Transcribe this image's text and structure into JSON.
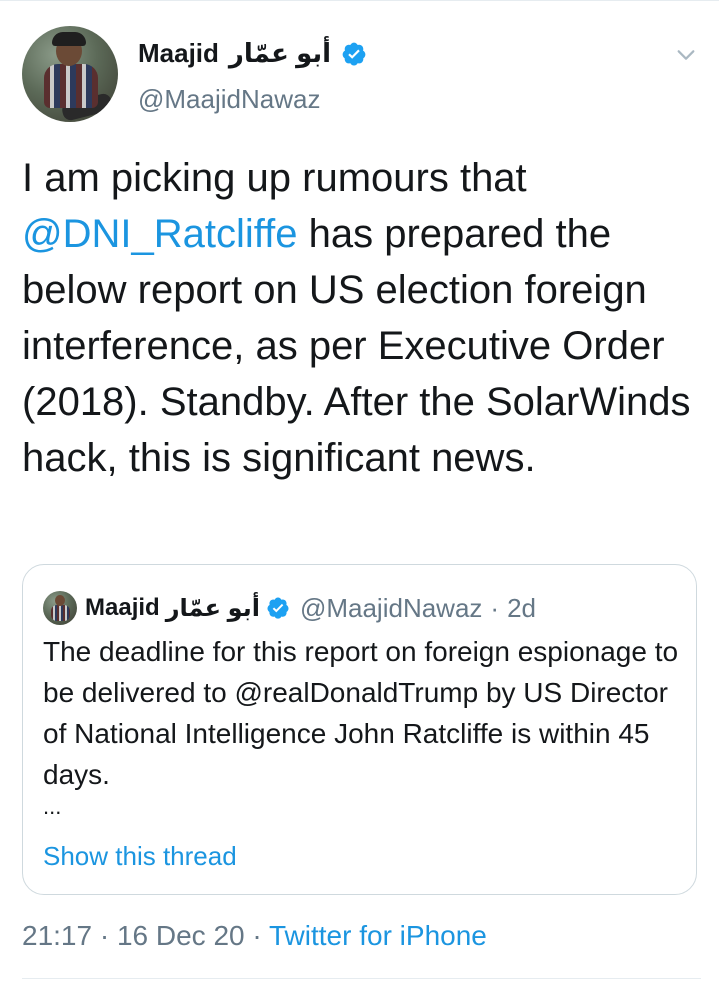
{
  "tweet": {
    "author": {
      "display_name": "Maajid",
      "arabic_name": "أبو عمّار",
      "handle": "@MaajidNawaz",
      "verified_icon": "verified-badge-icon"
    },
    "text_parts": {
      "before_mention": "I am picking up rumours that ",
      "mention": "@DNI_Ratcliffe",
      "after_mention": " has prepared the below report on US election foreign interference, as per Executive Order (2018). Standby. After the SolarWinds hack, this is significant news."
    },
    "timestamp": "21:17 · 16 Dec 20",
    "separator": " · ",
    "source": "Twitter for iPhone"
  },
  "quoted_tweet": {
    "display_name": "Maajid",
    "arabic_name": "أبو عمّار",
    "handle": "@MaajidNawaz",
    "dot": "·",
    "age": "2d",
    "text": "The deadline for this report on foreign espionage to be delivered to @realDonaldTrump by US Director of National Intelligence John Ratcliffe is within 45 days.",
    "ellipsis": "...",
    "show_thread_label": "Show this thread"
  },
  "colors": {
    "link_blue": "#1b95e0",
    "secondary_gray": "#657786",
    "verified_blue": "#1da1f2"
  }
}
